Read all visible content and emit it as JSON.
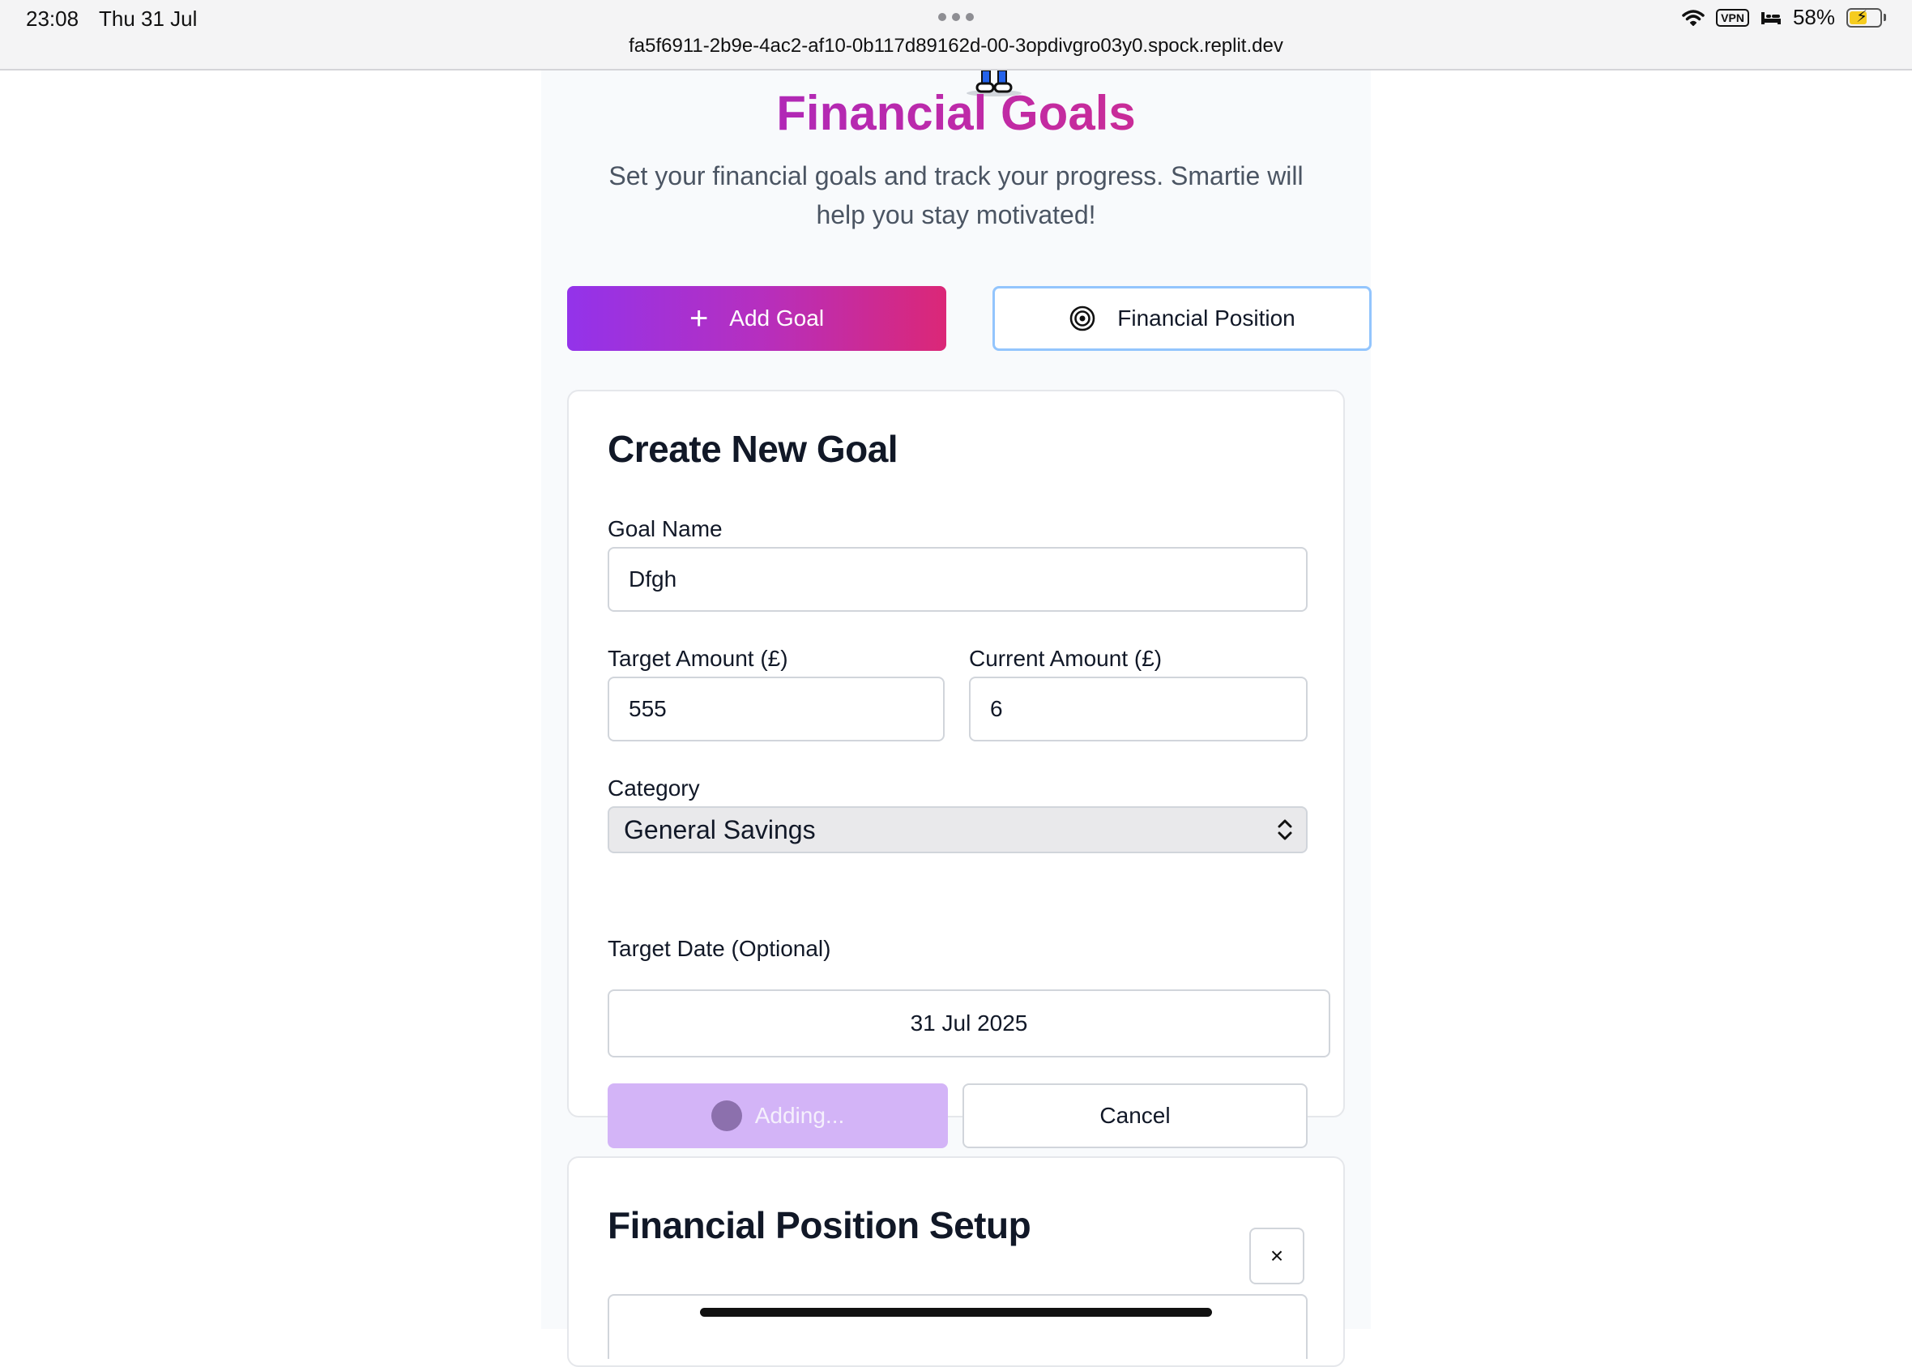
{
  "status_bar": {
    "time": "23:08",
    "date": "Thu 31 Jul",
    "url": "fa5f6911-2b9e-4ac2-af10-0b117d89162d-00-3opdivgro03y0.spock.replit.dev",
    "vpn": "VPN",
    "battery": "58%",
    "battery_level": 0.58
  },
  "header": {
    "title": "Financial Goals",
    "subtitle": "Set your financial goals and track your progress. Smartie will help you stay motivated!"
  },
  "actions": {
    "add_goal": "Add Goal",
    "financial_position": "Financial Position"
  },
  "create_goal": {
    "heading": "Create New Goal",
    "goal_name_label": "Goal Name",
    "goal_name_value": "Dfgh",
    "target_amount_label": "Target Amount (£)",
    "target_amount_value": "555",
    "current_amount_label": "Current Amount (£)",
    "current_amount_value": "6",
    "category_label": "Category",
    "category_value": "General Savings",
    "target_date_label": "Target Date (Optional)",
    "target_date_value": "31 Jul 2025",
    "submit_label": "Adding...",
    "cancel_label": "Cancel"
  },
  "financial_position_setup": {
    "heading": "Financial Position Setup",
    "close_label": "×"
  },
  "colors": {
    "brand_gradient_start": "#9333ea",
    "brand_gradient_end": "#db2777",
    "outline_accent": "#93c5fd",
    "adding_button_bg": "#d3b4f7"
  }
}
